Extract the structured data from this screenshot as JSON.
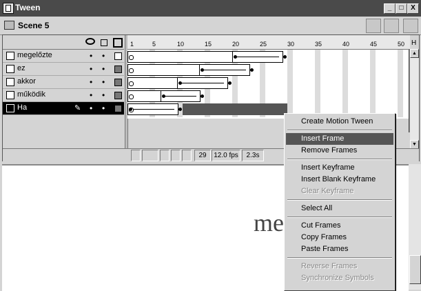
{
  "window": {
    "title": "Tween",
    "minimize": "_",
    "maximize": "□",
    "close": "X"
  },
  "scene": {
    "name": "Scene 5"
  },
  "timeline": {
    "ruler_ticks": [
      "1",
      "5",
      "10",
      "15",
      "20",
      "25",
      "30",
      "35",
      "40",
      "45",
      "50"
    ],
    "ruler_end": "H",
    "layers": [
      {
        "name": "megelőzte",
        "selected": false
      },
      {
        "name": "ez",
        "selected": false
      },
      {
        "name": "akkor",
        "selected": false
      },
      {
        "name": "működik",
        "selected": false
      },
      {
        "name": "Ha",
        "selected": true
      }
    ],
    "current_frame": "29",
    "fps": "12.0 fps",
    "elapsed": "2.3s"
  },
  "stage": {
    "visible_text": "mec"
  },
  "context_menu": {
    "items": [
      {
        "label": "Create Motion Tween",
        "enabled": true,
        "highlighted": false
      },
      {
        "sep": true
      },
      {
        "label": "Insert Frame",
        "enabled": true,
        "highlighted": true
      },
      {
        "label": "Remove Frames",
        "enabled": true,
        "highlighted": false
      },
      {
        "sep": true
      },
      {
        "label": "Insert Keyframe",
        "enabled": true,
        "highlighted": false
      },
      {
        "label": "Insert Blank Keyframe",
        "enabled": true,
        "highlighted": false
      },
      {
        "label": "Clear Keyframe",
        "enabled": false,
        "highlighted": false
      },
      {
        "sep": true
      },
      {
        "label": "Select All",
        "enabled": true,
        "highlighted": false
      },
      {
        "sep": true
      },
      {
        "label": "Cut Frames",
        "enabled": true,
        "highlighted": false
      },
      {
        "label": "Copy Frames",
        "enabled": true,
        "highlighted": false
      },
      {
        "label": "Paste Frames",
        "enabled": true,
        "highlighted": false
      },
      {
        "sep": true
      },
      {
        "label": "Reverse Frames",
        "enabled": false,
        "highlighted": false
      },
      {
        "label": "Synchronize Symbols",
        "enabled": false,
        "highlighted": false
      }
    ]
  }
}
